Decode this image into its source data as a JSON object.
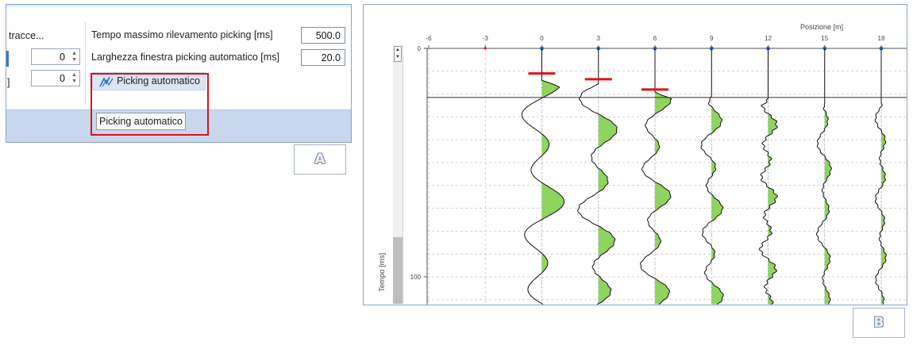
{
  "panel_a": {
    "partial_label": "tracce...",
    "partial_bracket": "]",
    "max_time_label": "Tempo massimo rilevamento picking [ms]",
    "max_time_value": "500.0",
    "window_width_label": "Larghezza finestra picking automatico [ms]",
    "window_width_value": "20.0",
    "spinner_1_value": "0",
    "spinner_2_value": "0",
    "auto_picking_button": "Picking automatico",
    "tooltip": "Picking automatico",
    "tag": "A",
    "highlight_color": "#e0101a"
  },
  "panel_b": {
    "x_axis_title": "Posizione [m]",
    "y_axis_title": "Tempo [ms]",
    "tag": "B",
    "x_ticks": [
      "-6",
      "-3",
      "0",
      "3",
      "6",
      "9",
      "12",
      "15",
      "18"
    ],
    "y_ticks": [
      "0",
      "100"
    ],
    "fill_color": "#8fd45f",
    "pick_color": "#e0101a",
    "chart_data": {
      "type": "line",
      "x": [
        -6,
        -3,
        0,
        3,
        6,
        9,
        12,
        15,
        18
      ],
      "xlabel": "Posizione [m]",
      "ylabel": "Tempo [ms]",
      "xlim": [
        -7,
        19
      ],
      "ylim": [
        0,
        110
      ],
      "trace_positions": [
        0,
        3,
        6,
        9,
        12,
        15,
        18
      ],
      "picks": [
        {
          "x": 0,
          "t": 11
        },
        {
          "x": 3,
          "t": 13.5
        },
        {
          "x": 6,
          "t": 18
        }
      ],
      "picking_max_time_line": 21.5
    }
  }
}
